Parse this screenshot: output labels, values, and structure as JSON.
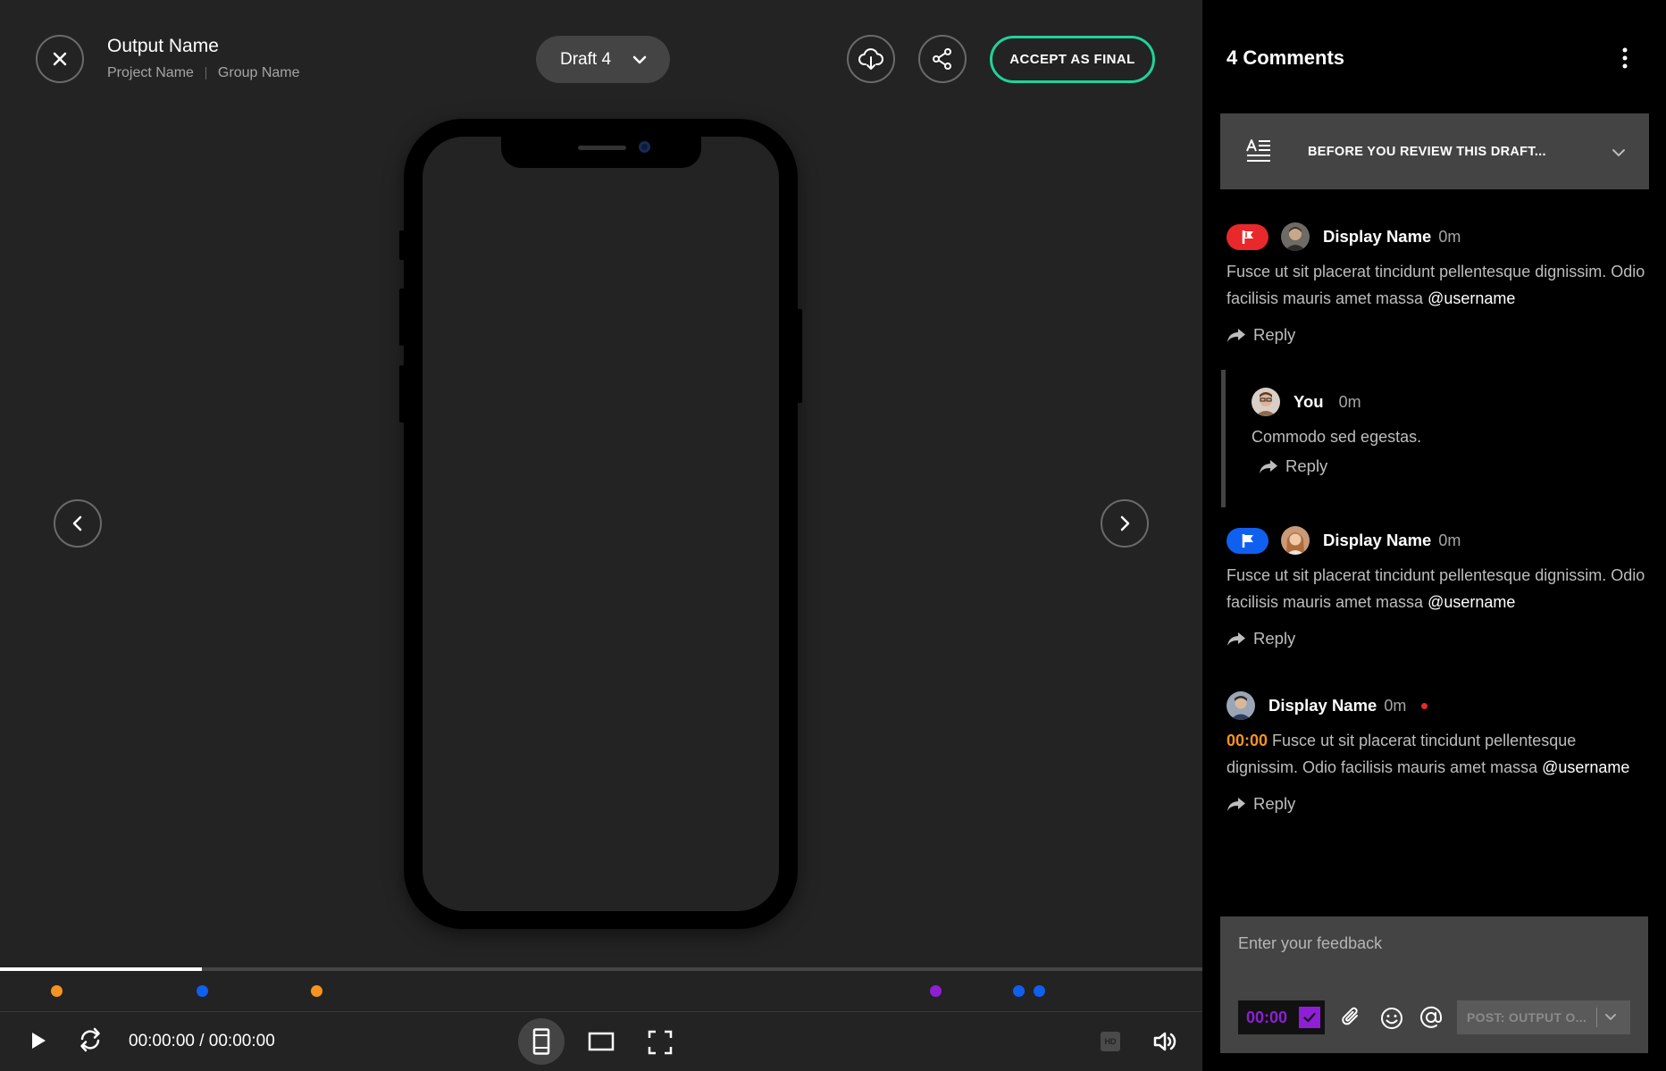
{
  "header": {
    "output_name": "Output Name",
    "project_name": "Project Name",
    "group_name": "Group Name",
    "draft_label": "Draft 4",
    "accept_label": "ACCEPT AS FINAL"
  },
  "player": {
    "timecode": "00:00:00 / 00:00:00",
    "progress_fraction": 0.168,
    "hd_label": "HD",
    "markers": [
      {
        "color": "#f7931e",
        "position_fraction": 0.047
      },
      {
        "color": "#1060f0",
        "position_fraction": 0.168
      },
      {
        "color": "#f7931e",
        "position_fraction": 0.263
      },
      {
        "color": "#8f1fd6",
        "position_fraction": 0.778
      },
      {
        "color": "#1060f0",
        "position_fraction": 0.847
      },
      {
        "color": "#1060f0",
        "position_fraction": 0.864
      }
    ]
  },
  "panel": {
    "title": "4 Comments",
    "banner_label": "BEFORE YOU REVIEW THIS DRAFT...",
    "comments": [
      {
        "flag_color": "#e8282b",
        "author": "Display Name",
        "time": "0m",
        "text_before_mention": "Fusce ut sit placerat tincidunt pellentesque dignissim. Odio facilisis mauris amet massa ",
        "mention": "@username",
        "reply_label": "Reply"
      },
      {
        "author": "You",
        "time": "0m",
        "text": "Commodo sed egestas.",
        "reply_label": "Reply"
      },
      {
        "flag_color": "#1060f0",
        "author": "Display Name",
        "time": "0m",
        "text_before_mention": "Fusce ut sit placerat tincidunt pellentesque dignissim. Odio facilisis mauris amet massa ",
        "mention": "@username",
        "reply_label": "Reply"
      },
      {
        "author": "Display Name",
        "time": "0m",
        "stamp": "00:00",
        "text_before_mention": " Fusce ut sit placerat tincidunt pellentesque dignissim. Odio facilisis mauris amet massa ",
        "mention": "@username",
        "reply_label": "Reply"
      }
    ]
  },
  "composer": {
    "placeholder": "Enter your feedback",
    "timestamp": "00:00",
    "post_label": "POST: OUTPUT O..."
  },
  "icons": [
    "close-icon",
    "chevron-down-icon",
    "cloud-download-icon",
    "share-icon",
    "chevron-left-icon",
    "chevron-right-icon",
    "play-icon",
    "loop-icon",
    "mobile-view-icon",
    "desktop-view-icon",
    "fullscreen-icon",
    "volume-icon",
    "more-vertical-icon",
    "document-text-icon",
    "flag-icon",
    "reply-arrow-icon",
    "paperclip-icon",
    "emoji-icon",
    "at-icon",
    "check-icon"
  ],
  "colors": {
    "accent_green": "#1fd39a",
    "marker_orange": "#f7931e",
    "marker_blue": "#1060f0",
    "marker_purple": "#8f1fd6",
    "flag_red": "#e8282b"
  }
}
